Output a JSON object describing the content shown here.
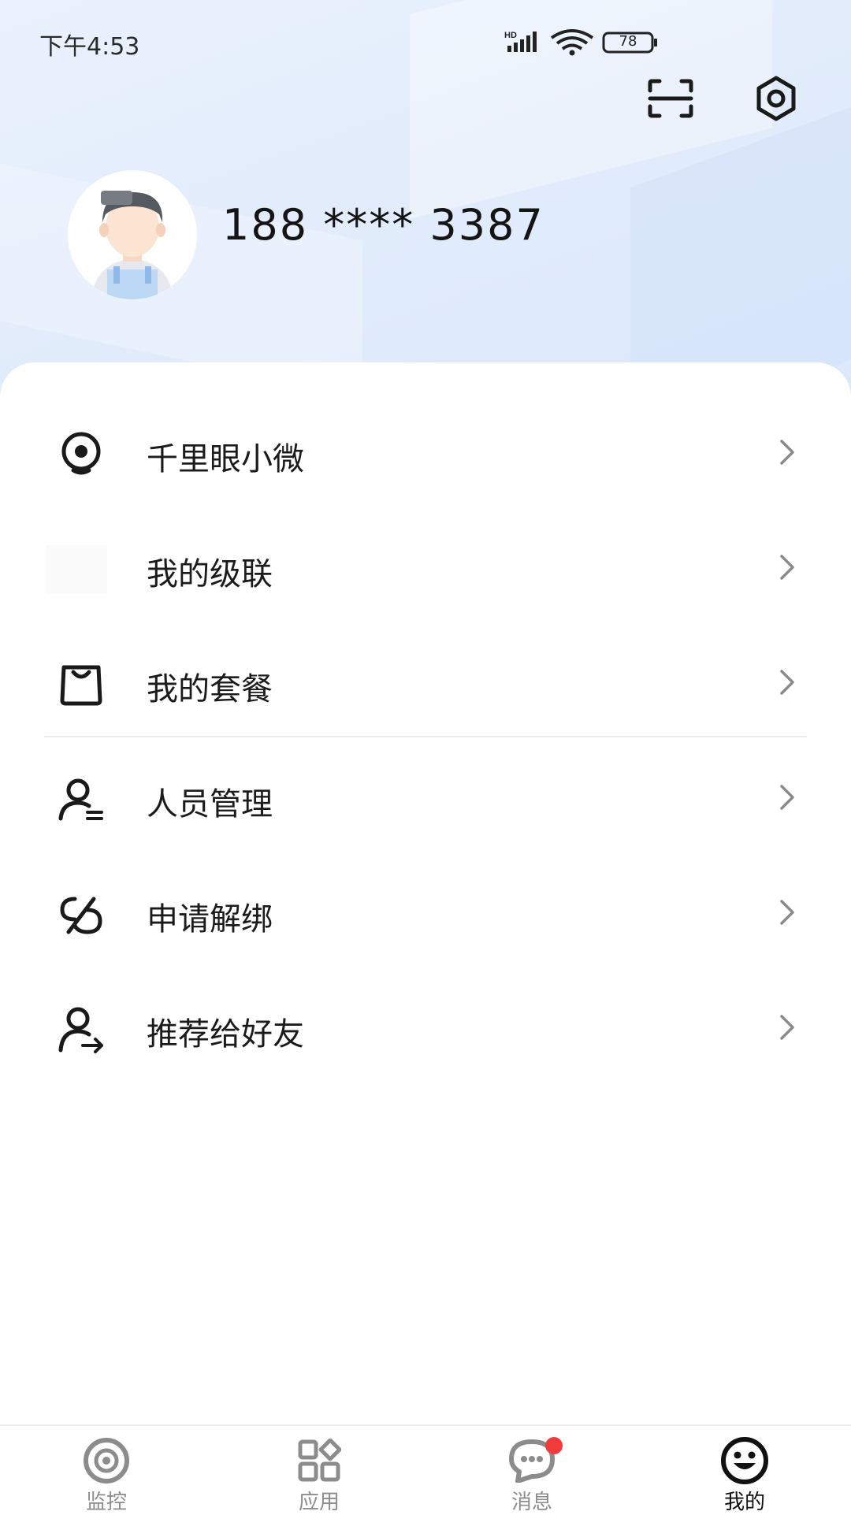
{
  "status_bar": {
    "time": "下午4:53",
    "network_label": "HD",
    "battery": "78"
  },
  "header": {
    "scan_icon": "scan-icon",
    "settings_icon": "hexagon-settings-icon"
  },
  "profile": {
    "phone": "188 **** 3387",
    "avatar_icon": "user-avatar"
  },
  "menu": {
    "items": [
      {
        "label": "千里眼小微",
        "icon": "eye-camera-icon"
      },
      {
        "label": "我的级联",
        "icon": "cascade-icon"
      },
      {
        "label": "我的套餐",
        "icon": "shopping-bag-icon"
      },
      {
        "label": "人员管理",
        "icon": "user-manage-icon"
      },
      {
        "label": "申请解绑",
        "icon": "unlink-icon"
      },
      {
        "label": "推荐给好友",
        "icon": "user-share-icon"
      }
    ]
  },
  "tabbar": {
    "tabs": [
      {
        "label": "监控",
        "icon": "eye-icon"
      },
      {
        "label": "应用",
        "icon": "apps-grid-icon"
      },
      {
        "label": "消息",
        "icon": "message-icon",
        "badge": true
      },
      {
        "label": "我的",
        "icon": "smile-icon",
        "active": true
      }
    ]
  },
  "colors": {
    "header_bg": "#e2ecfb",
    "badge": "#f23b3b",
    "text_primary": "#1b1b1b",
    "tab_inactive": "#8c8c8c",
    "tab_active": "#111111"
  }
}
